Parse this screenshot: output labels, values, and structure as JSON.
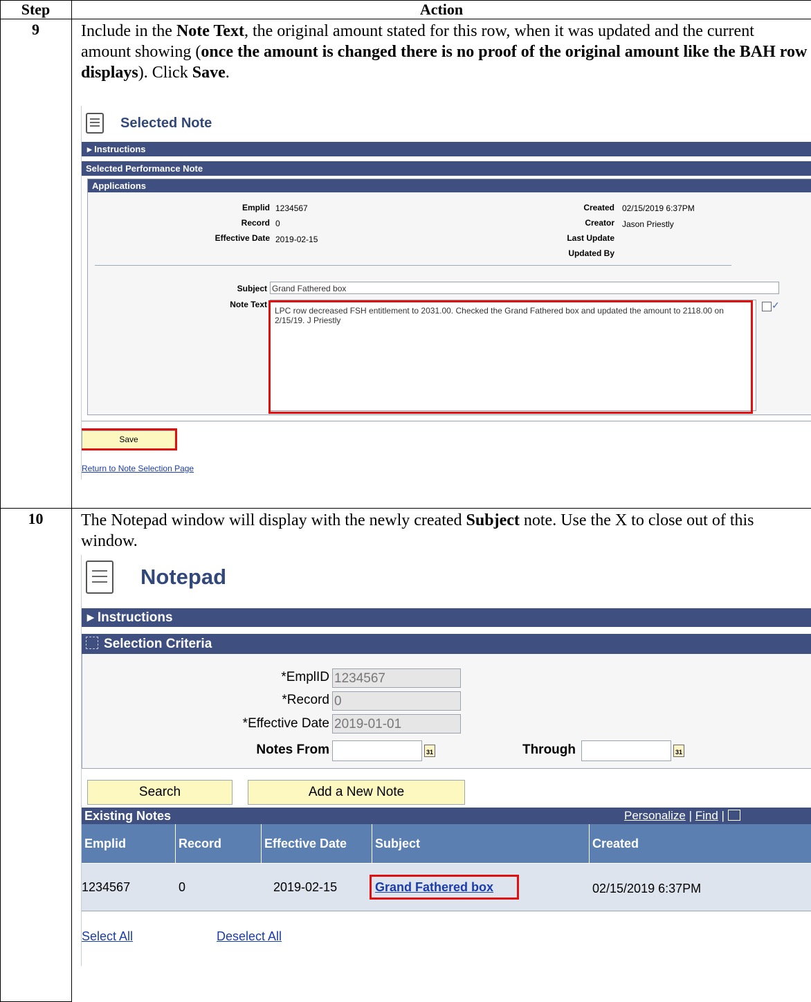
{
  "table": {
    "header_step": "Step",
    "header_action": "Action"
  },
  "steps": [
    {
      "number": "9",
      "instruction": {
        "t1": "Include in the ",
        "b1": "Note Text",
        "t2": ", the original amount stated for this row, when it was updated and the current amount showing (",
        "b2": "once the amount is changed there is no proof of the original amount like the BAH row displays",
        "t3": "). Click ",
        "b3": "Save",
        "t4": "."
      }
    },
    {
      "number": "10",
      "instruction": {
        "t1": "The Notepad window will display with the newly created ",
        "b1": "Subject",
        "t2": " note. Use the X to close out of this window."
      }
    }
  ],
  "selected_note": {
    "title": "Selected Note",
    "instructions_bar": "Instructions",
    "performance_bar": "Selected Performance Note",
    "applications_bar": "Applications",
    "fields": {
      "emplid_label": "Emplid",
      "emplid_value": "1234567",
      "record_label": "Record",
      "record_value": "0",
      "effdate_label": "Effective Date",
      "effdate_value": "2019-02-15",
      "created_label": "Created",
      "created_value": "02/15/2019 6:37PM",
      "creator_label": "Creator",
      "creator_value": "Jason Priestly",
      "last_update_label": "Last Update",
      "updated_by_label": "Updated By",
      "subject_label": "Subject",
      "subject_value": "Grand Fathered box",
      "note_text_label": "Note Text",
      "note_text_value": "LPC row decreased FSH entitlement to 2031.00. Checked the Grand  Fathered box and updated the amount to 2118.00 on 2/15/19. J Priestly"
    },
    "save_button": "Save",
    "return_link": "Return to Note Selection Page"
  },
  "notepad": {
    "title": "Notepad",
    "instructions_bar": "Instructions",
    "selection_bar": "Selection Criteria",
    "emplid_label": "*EmplID",
    "emplid_value": "1234567",
    "record_label": "*Record",
    "record_value": "0",
    "effdate_label": "*Effective Date",
    "effdate_value": "2019-01-01",
    "notes_from_label": "Notes From",
    "through_label": "Through",
    "calendar_icon_text": "31",
    "search_button": "Search",
    "add_button": "Add a New Note",
    "existing_notes_title": "Existing Notes",
    "personalize_link": "Personalize",
    "find_link": "Find",
    "separator": "|",
    "columns": [
      "Emplid",
      "Record",
      "Effective Date",
      "Subject",
      "Created"
    ],
    "rows": [
      {
        "emplid": "1234567",
        "record": "0",
        "effdate": "2019-02-15",
        "subject": "Grand Fathered box",
        "created": "02/15/2019 6:37PM"
      }
    ],
    "select_all": "Select All",
    "deselect_all": "Deselect All"
  },
  "colors": {
    "bar": "#3f4f7f",
    "grid_header": "#5a7fb0",
    "highlight": "#e01010",
    "button": "#fcf8c0"
  }
}
